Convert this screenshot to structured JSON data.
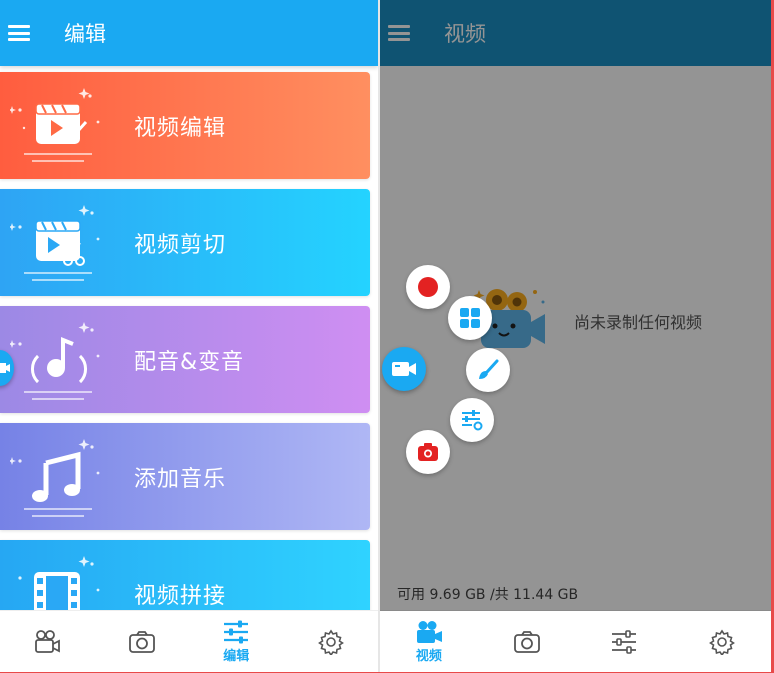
{
  "left": {
    "title": "编辑",
    "cards": [
      {
        "label": "视频编辑",
        "icon": "video-edit-icon"
      },
      {
        "label": "视频剪切",
        "icon": "video-cut-icon"
      },
      {
        "label": "配音&变音",
        "icon": "voice-icon"
      },
      {
        "label": "添加音乐",
        "icon": "music-note-icon"
      },
      {
        "label": "视频拼接",
        "icon": "film-join-icon"
      }
    ],
    "nav": [
      {
        "icon": "video-camera-icon",
        "label": ""
      },
      {
        "icon": "camera-icon",
        "label": ""
      },
      {
        "icon": "sliders-icon",
        "label": "编辑"
      },
      {
        "icon": "gear-icon",
        "label": ""
      }
    ]
  },
  "right": {
    "title": "视频",
    "empty_text": "尚未录制任何视频",
    "storage": "可用 9.69 GB /共 11.44 GB",
    "nav": [
      {
        "icon": "video-camera-icon",
        "label": "视频"
      },
      {
        "icon": "camera-icon",
        "label": ""
      },
      {
        "icon": "sliders-icon",
        "label": ""
      },
      {
        "icon": "gear-icon",
        "label": ""
      }
    ]
  },
  "colors": {
    "primary": "#1aa9f2",
    "card_gradients": [
      "#ff6a45-#ff8a5c",
      "#2ea8f5-#27d0ff",
      "#9b8be6-#c98cf0",
      "#7a84e8-#aab4f4",
      "#24a7f3-#2fd1ff"
    ],
    "record_red": "#e32222"
  }
}
